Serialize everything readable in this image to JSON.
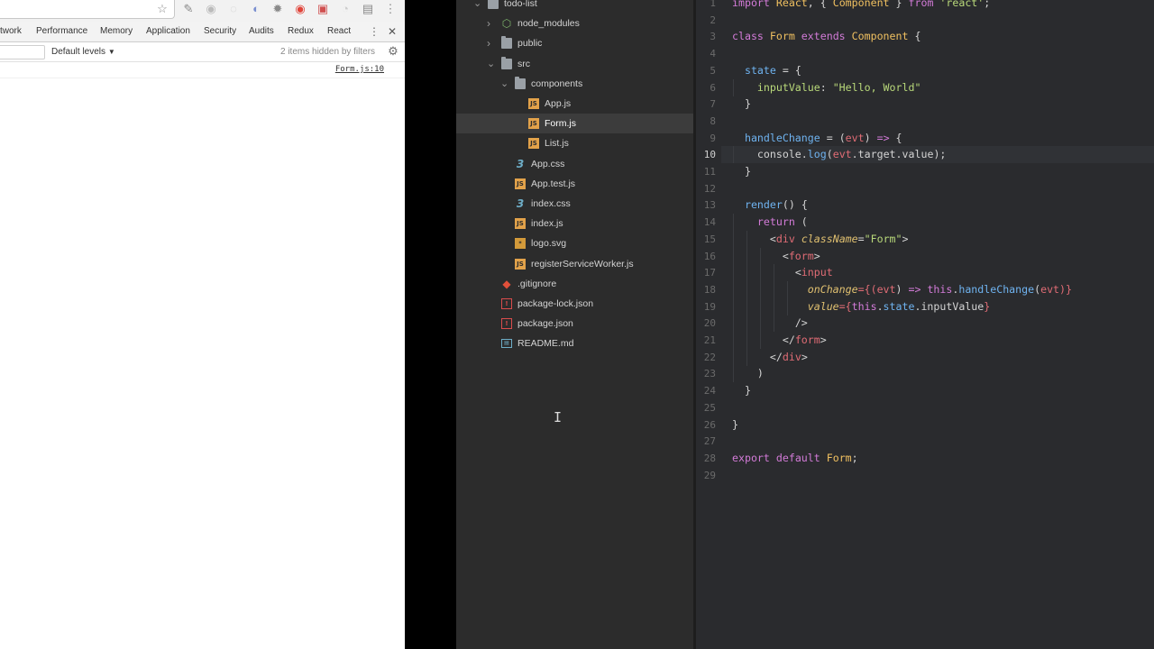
{
  "devtools": {
    "tabs": [
      "twork",
      "Performance",
      "Memory",
      "Application",
      "Security",
      "Audits",
      "Redux",
      "React"
    ],
    "filter_placeholder": "",
    "levels_label": "Default levels",
    "levels_caret": "▼",
    "hidden_count": "2 items hidden by filters",
    "message_source": "Form.js:10",
    "toolbar_icons": [
      "star-icon",
      "eyedropper-icon",
      "extension-icon",
      "extension-icon",
      "globe-icon",
      "bug-icon",
      "record-icon",
      "extension-icon",
      "extension-icon",
      "film-icon",
      "more-vert-icon"
    ]
  },
  "file_tree": {
    "items": [
      {
        "label": "todo-list",
        "kind": "folder",
        "expanded": true
      },
      {
        "label": "node_modules",
        "kind": "node",
        "expanded": false
      },
      {
        "label": "public",
        "kind": "folder",
        "expanded": false
      },
      {
        "label": "src",
        "kind": "folder",
        "expanded": true
      },
      {
        "label": "components",
        "kind": "folder",
        "expanded": true
      },
      {
        "label": "App.js",
        "kind": "js"
      },
      {
        "label": "Form.js",
        "kind": "js",
        "selected": true
      },
      {
        "label": "List.js",
        "kind": "js"
      },
      {
        "label": "App.css",
        "kind": "css"
      },
      {
        "label": "App.test.js",
        "kind": "js"
      },
      {
        "label": "index.css",
        "kind": "css"
      },
      {
        "label": "index.js",
        "kind": "js"
      },
      {
        "label": "logo.svg",
        "kind": "svg"
      },
      {
        "label": "registerServiceWorker.js",
        "kind": "js"
      },
      {
        "label": ".gitignore",
        "kind": "git"
      },
      {
        "label": "package-lock.json",
        "kind": "pkg"
      },
      {
        "label": "package.json",
        "kind": "pkg"
      },
      {
        "label": "README.md",
        "kind": "md"
      }
    ]
  },
  "editor": {
    "active_line": 10,
    "lines": [
      "import React, { Component } from 'react';",
      "",
      "class Form extends Component {",
      "",
      "  state = {",
      "    inputValue: \"Hello, World\"",
      "  }",
      "",
      "  handleChange = (evt) => {",
      "    console.log(evt.target.value);",
      "  }",
      "",
      "  render() {",
      "    return (",
      "      <div className=\"Form\">",
      "        <form>",
      "          <input",
      "            onChange={(evt) => this.handleChange(evt)}",
      "            value={this.state.inputValue}",
      "          />",
      "        </form>",
      "      </div>",
      "    )",
      "  }",
      "",
      "}",
      "",
      "export default Form;",
      ""
    ]
  },
  "colors": {
    "tree_bg": "#2c2c2c",
    "editor_bg": "#2a2b2e",
    "keyword": "#d37bd8",
    "class": "#f0c060",
    "string": "#b9d97a",
    "function": "#6fb3f0",
    "tag": "#e06c75"
  }
}
